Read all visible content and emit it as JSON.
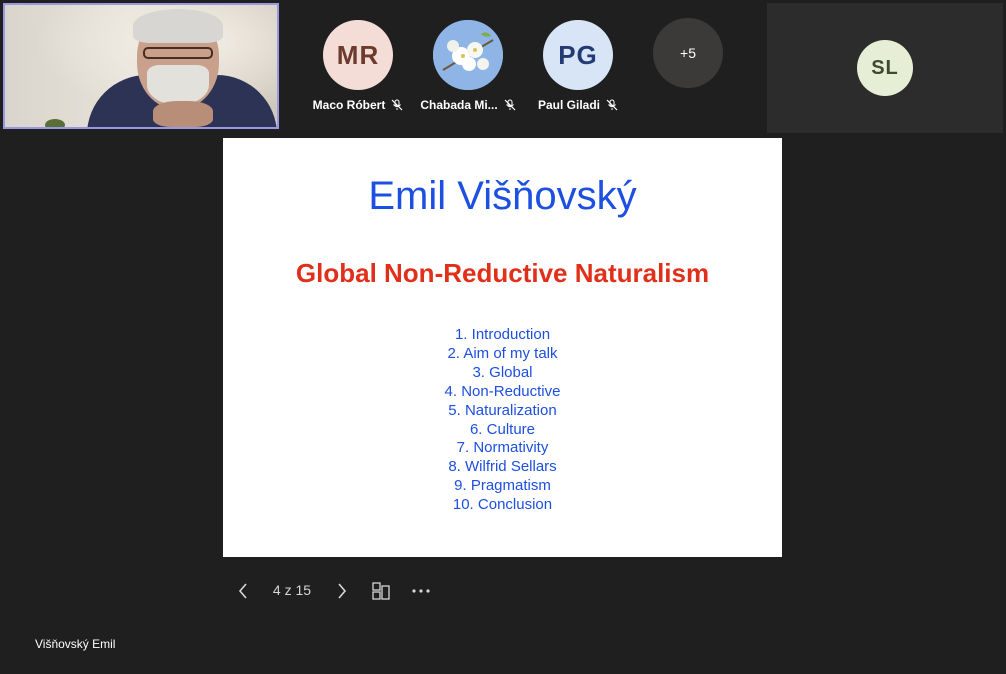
{
  "presenter_video": {
    "name": "Višňovský Emil"
  },
  "participants": [
    {
      "initials": "MR",
      "name": "Maco Róbert",
      "avatar_bg": "#f4ddd6",
      "avatar_fg": "#6b3b2b",
      "muted": true
    },
    {
      "initials": "",
      "name": "Chabada Mi...",
      "avatar_bg": "#8fb4e6",
      "avatar_fg": "#ffffff",
      "muted": true,
      "photo": "flower"
    },
    {
      "initials": "PG",
      "name": "Paul Giladi",
      "avatar_bg": "#d7e5f7",
      "avatar_fg": "#243a73",
      "muted": true
    }
  ],
  "more_participants": "+5",
  "side_tile": {
    "initials": "SL",
    "avatar_bg": "#e6efd6",
    "avatar_fg": "#3e4b2b"
  },
  "slide": {
    "title": "Emil Višňovský",
    "subtitle": "Global Non-Reductive Naturalism",
    "items": [
      "1. Introduction",
      "2. Aim of my talk",
      "3. Global",
      "4. Non-Reductive",
      "5. Naturalization",
      "6. Culture",
      "7. Normativity",
      "8. Wilfrid Sellars",
      "9. Pragmatism",
      "10. Conclusion"
    ],
    "colors": {
      "title": "#1d4fe0",
      "subtitle": "#e0301a",
      "list": "#1d4fe0"
    }
  },
  "controls": {
    "page_indicator": "4 z 15",
    "prev_icon": "chevron-left-icon",
    "next_icon": "chevron-right-icon",
    "layout_icon": "slide-layout-icon",
    "more_icon": "more-options-icon"
  },
  "presenter_label": "Višňovský Emil"
}
